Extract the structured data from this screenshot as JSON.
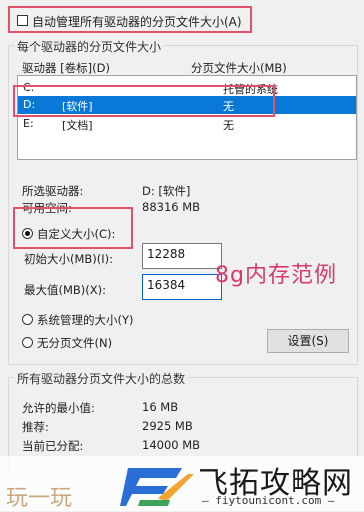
{
  "top": {
    "auto_manage_label": "自动管理所有驱动器的分页文件大小(A)",
    "auto_manage_checked": false
  },
  "per_drive": {
    "group_title": "每个驱动器的分页文件大小",
    "col_drive": "驱动器 [卷标](D)",
    "col_size": "分页文件大小(MB)",
    "rows": [
      {
        "drive": "C:",
        "label": "",
        "size": "托管的系统"
      },
      {
        "drive": "D:",
        "label": "[软件]",
        "size": "无"
      },
      {
        "drive": "E:",
        "label": "[文档]",
        "size": "无"
      }
    ],
    "selected_drive_label": "所选驱动器:",
    "selected_drive_value": "D:  [软件]",
    "available_label": "可用空间:",
    "available_value": "88316 MB",
    "custom_label": "自定义大小(C):",
    "initial_label": "初始大小(MB)(I):",
    "initial_value": "12288",
    "max_label": "最大值(MB)(X):",
    "max_value": "16384",
    "system_managed_label": "系统管理的大小(Y)",
    "no_paging_label": "无分页文件(N)",
    "set_button": "设置(S)"
  },
  "annotation": "8g内存范例",
  "totals": {
    "group_title": "所有驱动器分页文件大小的总数",
    "min_label": "允许的最小值:",
    "min_value": "16 MB",
    "recommended_label": "推荐:",
    "recommended_value": "2925 MB",
    "current_label": "当前已分配:",
    "current_value": "14000 MB"
  },
  "watermark": {
    "left_text": "玩一玩",
    "brand": "飞拓攻略网",
    "url": "— fiytounicont.com —"
  },
  "colors": {
    "highlight": "#e3506a",
    "selection": "#0a78d7",
    "annotation": "#d93a6a"
  }
}
